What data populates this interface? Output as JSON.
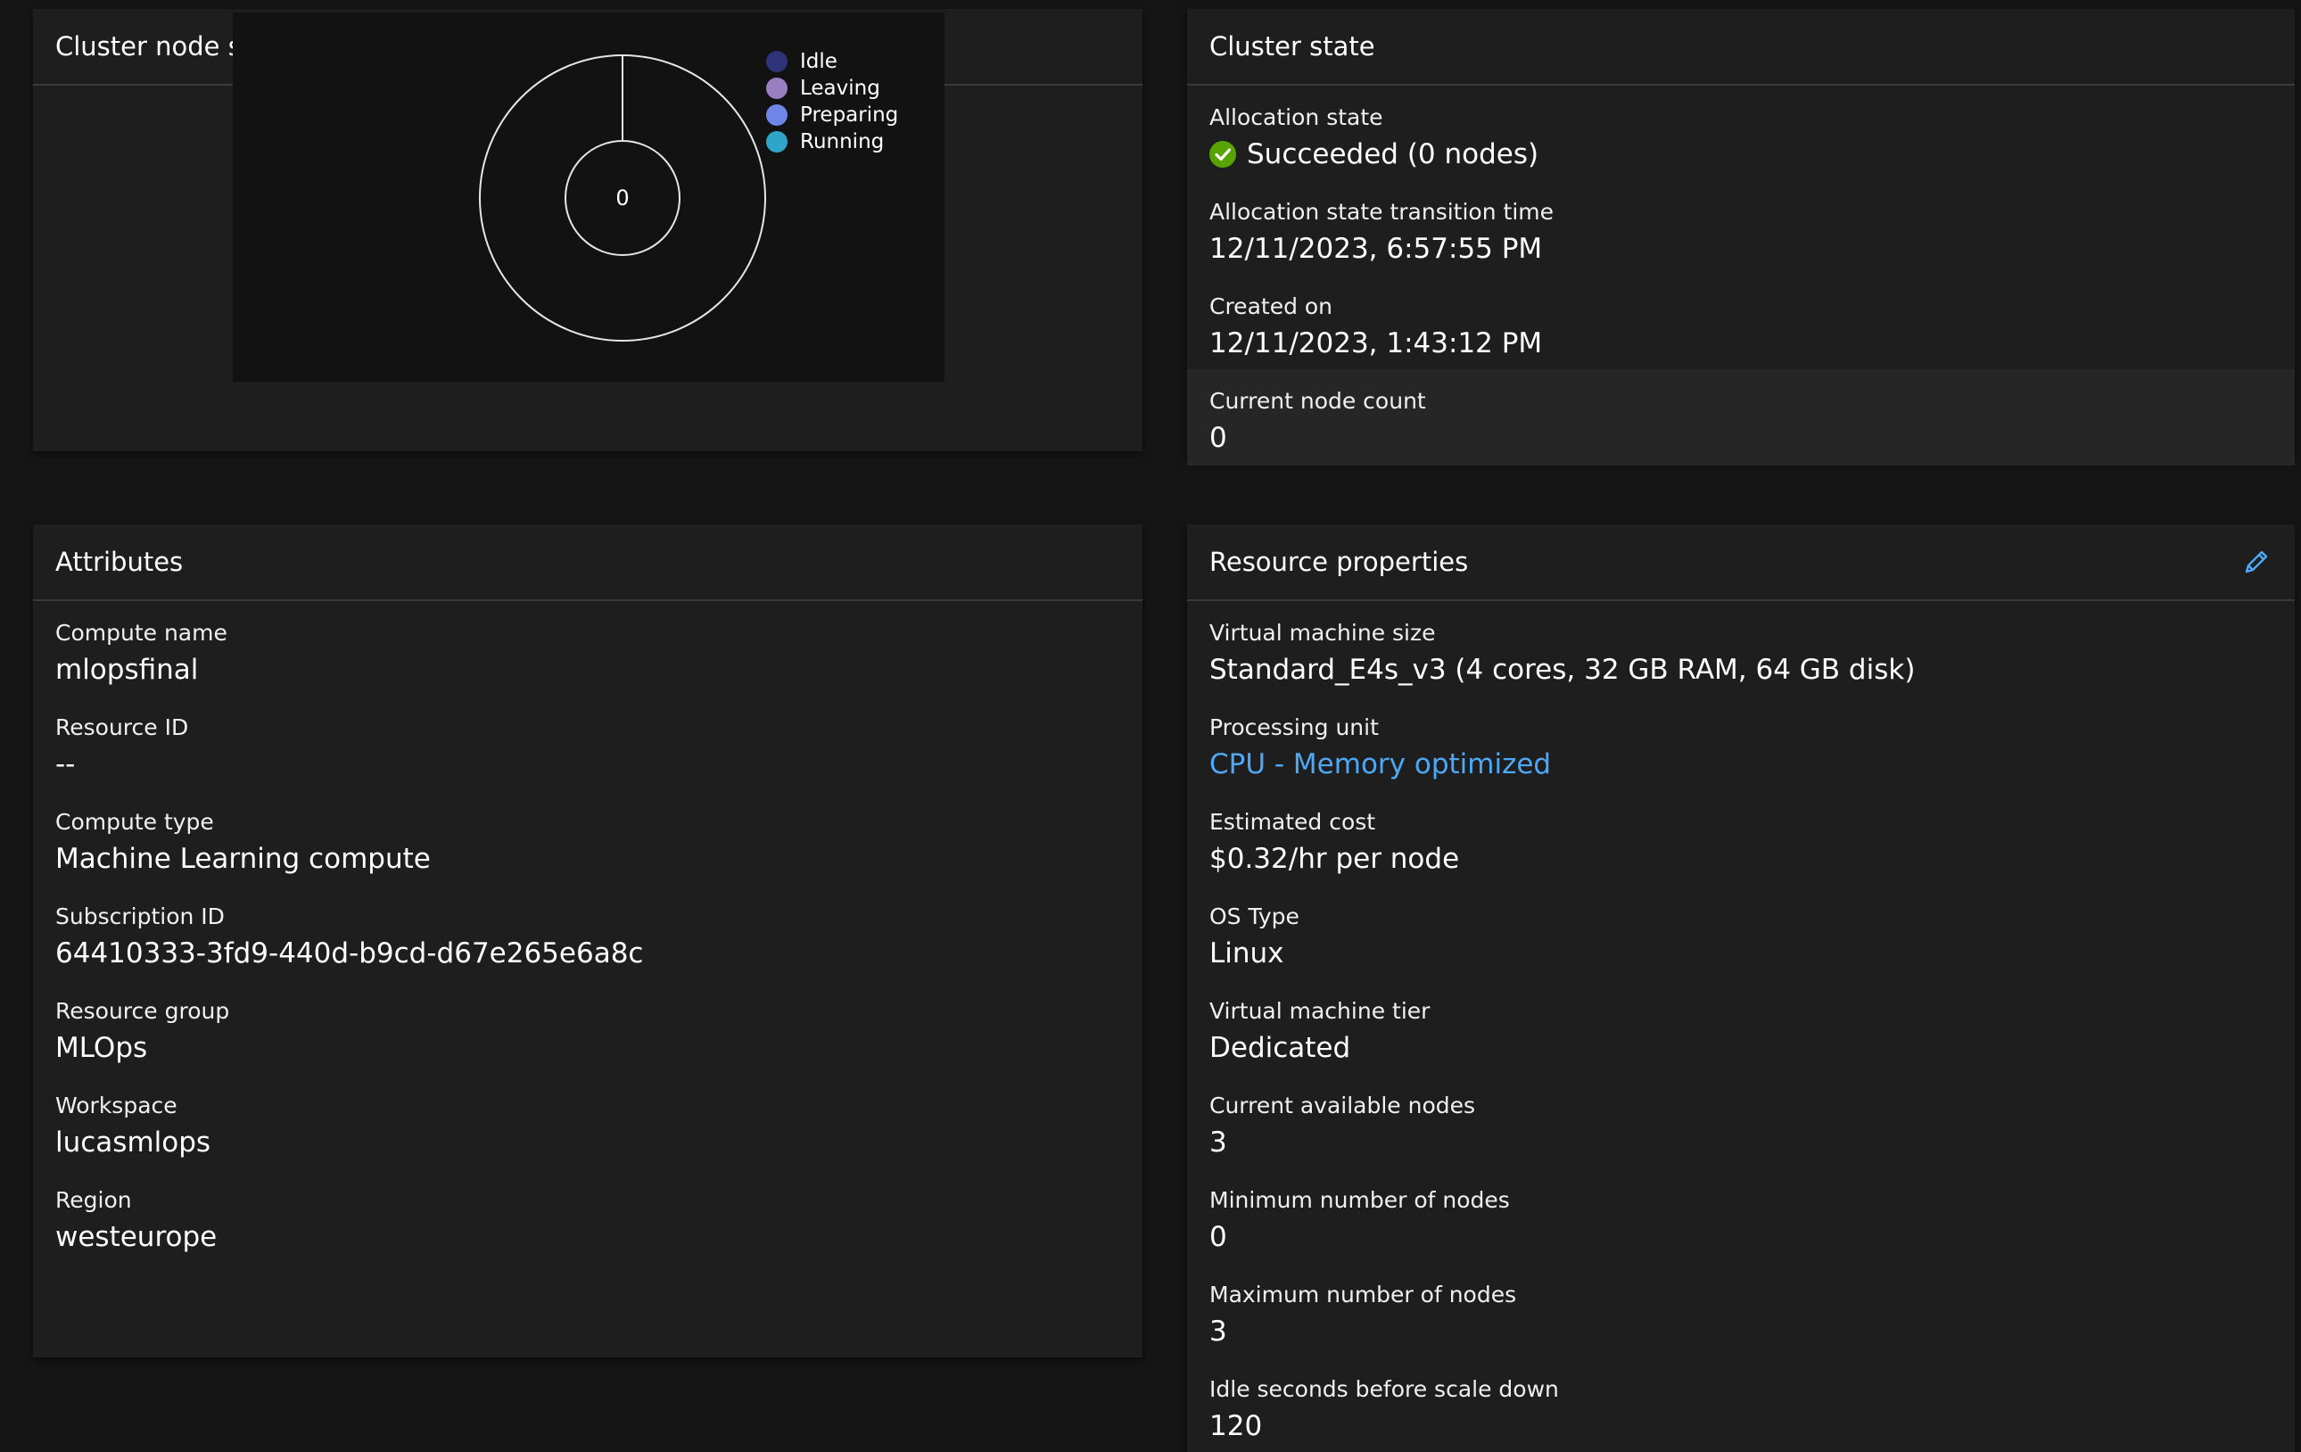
{
  "node_status": {
    "title": "Cluster node status",
    "center_value": "0",
    "legend": [
      {
        "label": "Idle",
        "color": "#2e3477"
      },
      {
        "label": "Leaving",
        "color": "#9a7fc0"
      },
      {
        "label": "Preparing",
        "color": "#6f86e8"
      },
      {
        "label": "Running",
        "color": "#2fa6c9"
      }
    ]
  },
  "chart_data": {
    "type": "pie",
    "style": "donut",
    "categories": [
      "Idle",
      "Leaving",
      "Preparing",
      "Running"
    ],
    "values": [
      0,
      0,
      0,
      0
    ],
    "total": 0,
    "legend_position": "top-right"
  },
  "cluster_state": {
    "title": "Cluster state",
    "allocation_state_label": "Allocation state",
    "allocation_state_value": "Succeeded (0 nodes)",
    "status_icon": "success-check-icon",
    "status_color": "#57a300",
    "transition_time_label": "Allocation state transition time",
    "transition_time_value": "12/11/2023, 6:57:55 PM",
    "created_on_label": "Created on",
    "created_on_value": "12/11/2023, 1:43:12 PM",
    "node_count_label": "Current node count",
    "node_count_value": "0"
  },
  "attributes": {
    "title": "Attributes",
    "fields": [
      {
        "label": "Compute name",
        "value": "mlopsfinal"
      },
      {
        "label": "Resource ID",
        "value": "--"
      },
      {
        "label": "Compute type",
        "value": "Machine Learning compute"
      },
      {
        "label": "Subscription ID",
        "value": "64410333-3fd9-440d-b9cd-d67e265e6a8c"
      },
      {
        "label": "Resource group",
        "value": "MLOps"
      },
      {
        "label": "Workspace",
        "value": "lucasmlops"
      },
      {
        "label": "Region",
        "value": "westeurope"
      }
    ]
  },
  "resource_properties": {
    "title": "Resource properties",
    "edit_icon": "pencil-icon",
    "link_color": "#4ea8f5",
    "fields": [
      {
        "label": "Virtual machine size",
        "value": "Standard_E4s_v3 (4 cores, 32 GB RAM, 64 GB disk)"
      },
      {
        "label": "Processing unit",
        "value": "CPU - Memory optimized"
      },
      {
        "label": "Estimated cost",
        "value": "$0.32/hr per node"
      },
      {
        "label": "OS Type",
        "value": "Linux"
      },
      {
        "label": "Virtual machine tier",
        "value": "Dedicated"
      },
      {
        "label": "Current available nodes",
        "value": "3"
      },
      {
        "label": "Minimum number of nodes",
        "value": "0"
      },
      {
        "label": "Maximum number of nodes",
        "value": "3"
      },
      {
        "label": "Idle seconds before scale down",
        "value": "120"
      }
    ]
  }
}
